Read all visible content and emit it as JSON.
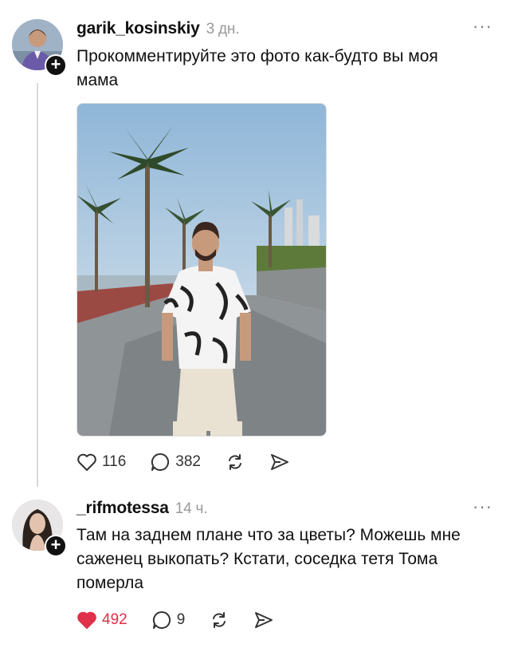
{
  "post1": {
    "username": "garik_kosinskiy",
    "time": "3 дн.",
    "more": "···",
    "text": "Прокомментируйте это фото как-будто вы моя мама",
    "likes": "116",
    "comments": "382"
  },
  "post2": {
    "username": "_rifmotessa",
    "time": "14 ч.",
    "more": "···",
    "text": "Там на заднем плане что за цветы?  Можешь мне саженец выкопать? Кстати, соседка тетя Тома померла",
    "likes": "492",
    "comments": "9"
  },
  "icons": {
    "like": "heart-icon",
    "comment": "comment-bubble-icon",
    "repost": "repost-icon",
    "share": "send-icon",
    "follow": "plus-icon"
  },
  "colors": {
    "like_active": "#e0304a",
    "thread_line": "#d9d9d9",
    "muted": "#9a9a9a"
  }
}
